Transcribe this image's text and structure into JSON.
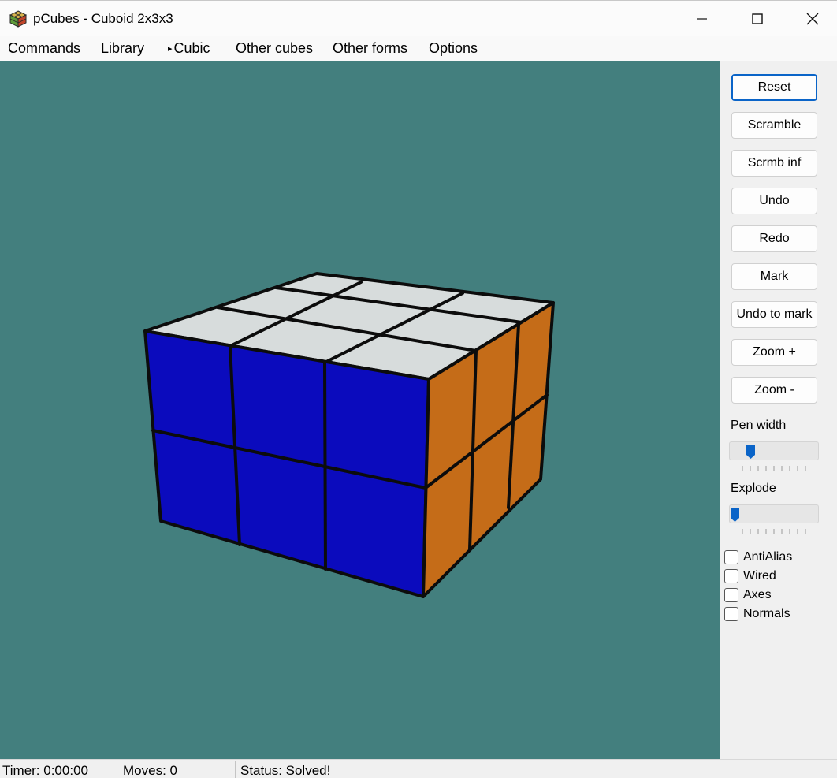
{
  "window": {
    "title": "pCubes - Cuboid 2x3x3",
    "icon": "cube-app-icon",
    "controls": [
      "minimize-icon",
      "maximize-icon",
      "close-icon"
    ]
  },
  "menu": {
    "items": [
      "Commands",
      "Library",
      "Cubic",
      "Other cubes",
      "Other forms",
      "Options"
    ],
    "active_marker": "▸"
  },
  "viewport": {
    "background": "#437f7e",
    "puzzle": "Cuboid 2x3x3",
    "face_colors": {
      "top": "#d7dcdc",
      "front": "#0b0bbd",
      "right": "#c56c18",
      "edge": "#0c0c0c"
    }
  },
  "side_panel": {
    "buttons": [
      "Reset",
      "Scramble",
      "Scrmb inf",
      "Undo",
      "Redo",
      "Mark",
      "Undo to mark",
      "Zoom +",
      "Zoom -"
    ],
    "default_button": "Reset",
    "pen_width_label": "Pen width",
    "pen_width_level": 0.2,
    "explode_label": "Explode",
    "explode_level": 0.0,
    "checkboxes": [
      {
        "label": "AntiAlias",
        "checked": false
      },
      {
        "label": "Wired",
        "checked": false
      },
      {
        "label": "Axes",
        "checked": false
      },
      {
        "label": "Normals",
        "checked": false
      }
    ],
    "accent": "#0a64c8"
  },
  "status": {
    "timer": "Timer: 0:00:00",
    "moves": "Moves: 0",
    "state": "Status: Solved!"
  }
}
